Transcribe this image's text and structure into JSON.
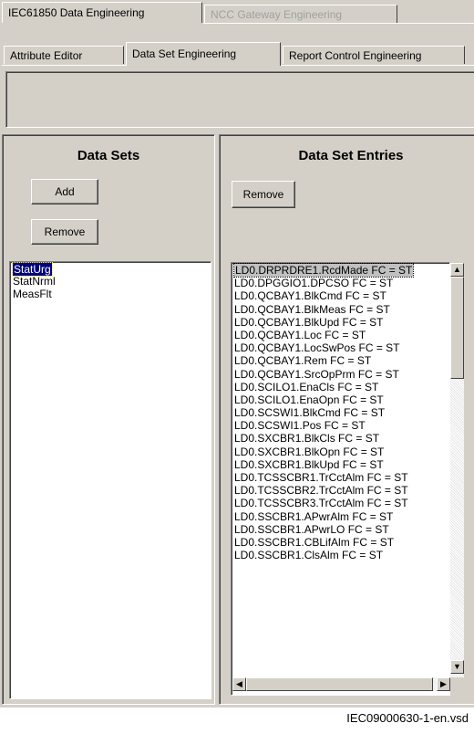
{
  "top_tabs": [
    {
      "label": "IEC61850 Data Engineering",
      "active": true
    },
    {
      "label": "NCC Gateway Engineering",
      "active": false
    }
  ],
  "sub_tabs": [
    {
      "label": "Attribute Editor"
    },
    {
      "label": "Data Set Engineering"
    },
    {
      "label": "Report Control Engineering"
    }
  ],
  "datasets_panel": {
    "title": "Data Sets",
    "add_label": "Add",
    "remove_label": "Remove",
    "items": [
      "StatUrg",
      "StatNrml",
      "MeasFlt"
    ],
    "selected_index": 0
  },
  "entries_panel": {
    "title": "Data Set Entries",
    "remove_label": "Remove",
    "items": [
      "LD0.DRPRDRE1.RcdMade FC = ST",
      "LD0.DPGGIO1.DPCSO FC = ST",
      "LD0.QCBAY1.BlkCmd FC = ST",
      "LD0.QCBAY1.BlkMeas FC = ST",
      "LD0.QCBAY1.BlkUpd FC = ST",
      "LD0.QCBAY1.Loc FC = ST",
      "LD0.QCBAY1.LocSwPos FC = ST",
      "LD0.QCBAY1.Rem FC = ST",
      "LD0.QCBAY1.SrcOpPrm FC = ST",
      "LD0.SCILO1.EnaCls FC = ST",
      "LD0.SCILO1.EnaOpn FC = ST",
      "LD0.SCSWI1.BlkCmd FC = ST",
      "LD0.SCSWI1.Pos FC = ST",
      "LD0.SXCBR1.BlkCls FC = ST",
      "LD0.SXCBR1.BlkOpn FC = ST",
      "LD0.SXCBR1.BlkUpd FC = ST",
      "LD0.TCSSCBR1.TrCctAlm FC = ST",
      "LD0.TCSSCBR2.TrCctAlm FC = ST",
      "LD0.TCSSCBR3.TrCctAlm FC = ST",
      "LD0.SSCBR1.APwrAlm FC = ST",
      "LD0.SSCBR1.APwrLO FC = ST",
      "LD0.SSCBR1.CBLifAlm FC = ST",
      "LD0.SSCBR1.ClsAlm FC = ST"
    ],
    "selected_index": 0
  },
  "caption": "IEC09000630-1-en.vsd"
}
